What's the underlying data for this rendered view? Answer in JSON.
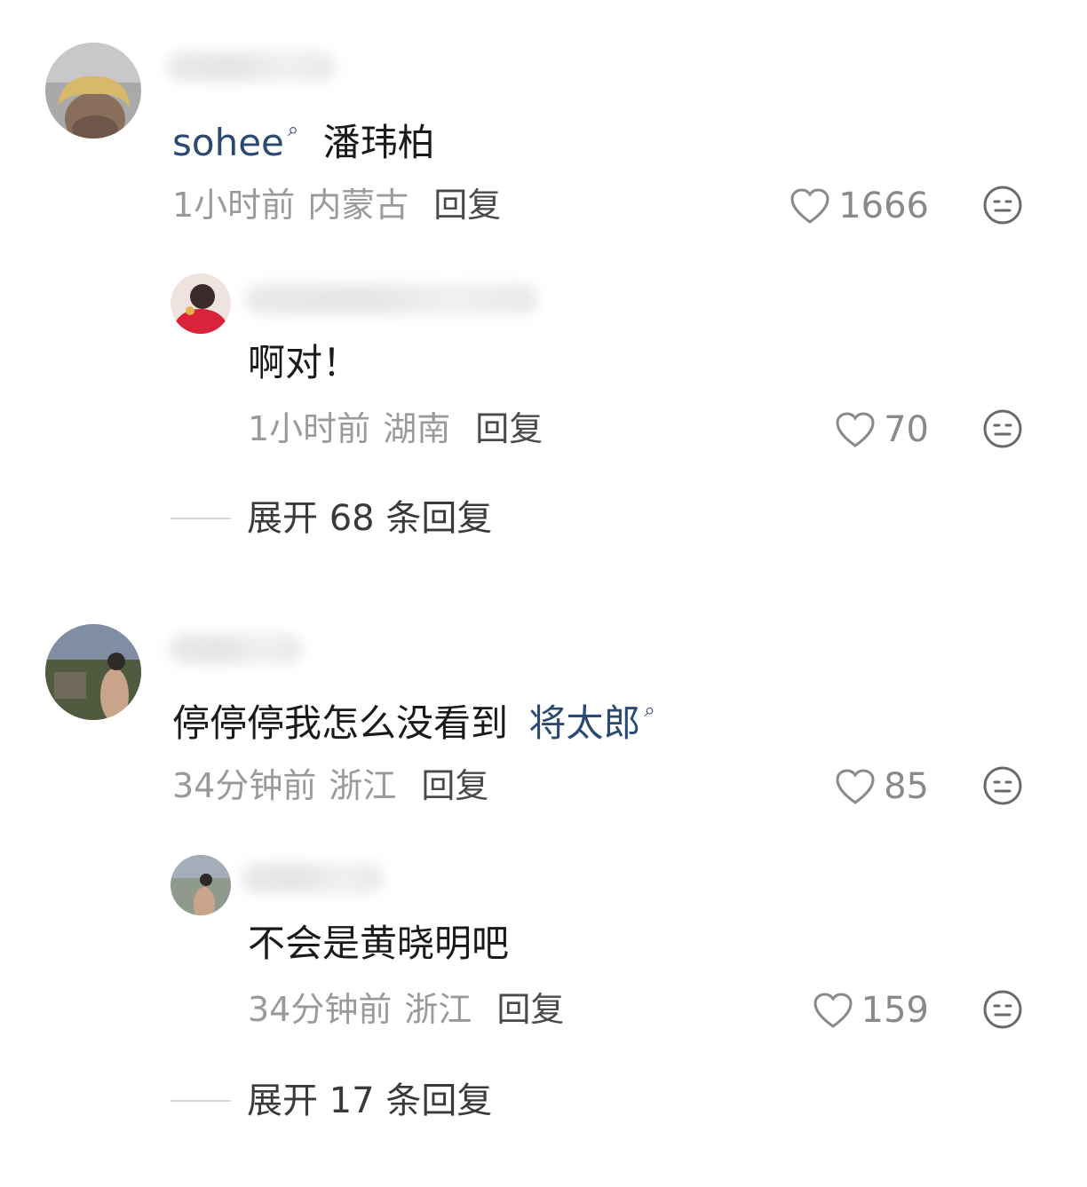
{
  "comments": [
    {
      "text_mention": "sohee",
      "text_rest": "潘玮柏",
      "time": "1小时前",
      "location": "内蒙古",
      "reply_label": "回复",
      "likes": "1666",
      "replies": [
        {
          "text": "啊对！",
          "time": "1小时前",
          "location": "湖南",
          "reply_label": "回复",
          "likes": "70"
        }
      ],
      "expand_label": "展开 68 条回复"
    },
    {
      "text_prefix": "停停停我怎么没看到",
      "text_mention": "将太郎",
      "time": "34分钟前",
      "location": "浙江",
      "reply_label": "回复",
      "likes": "85",
      "replies": [
        {
          "text": "不会是黄晓明吧",
          "time": "34分钟前",
          "location": "浙江",
          "reply_label": "回复",
          "likes": "159"
        }
      ],
      "expand_label": "展开 17 条回复"
    }
  ],
  "icons": {
    "like": "heart-outline-icon",
    "emoji": "neutral-face-icon",
    "mention": "search-icon"
  },
  "colors": {
    "mention": "#2b4a72",
    "meta": "#9a9a9a",
    "text": "#1a1a1a"
  }
}
